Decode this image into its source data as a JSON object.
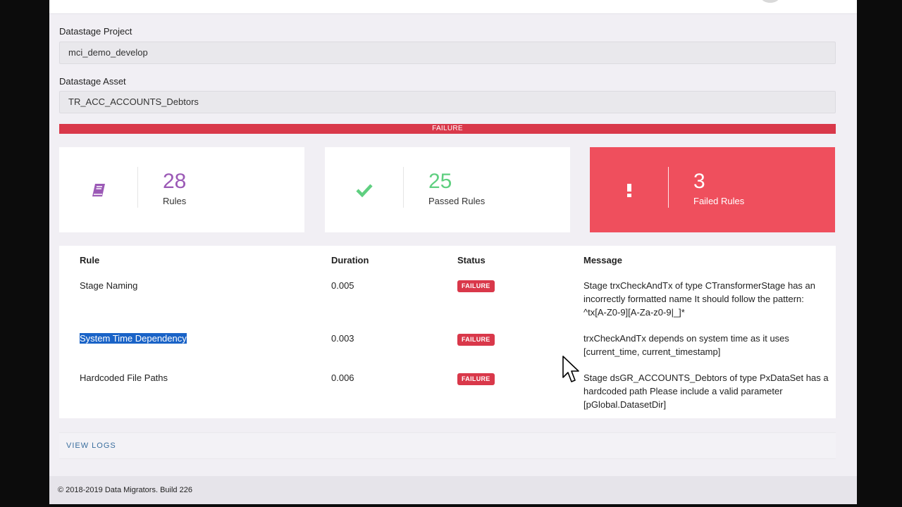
{
  "project": {
    "label": "Datastage Project",
    "value": "mci_demo_develop"
  },
  "asset": {
    "label": "Datastage Asset",
    "value": "TR_ACC_ACCOUNTS_Debtors"
  },
  "status_bar": {
    "text": "FAILURE",
    "color": "#d9384a"
  },
  "stats": [
    {
      "icon": "book-icon",
      "value": "28",
      "label": "Rules",
      "color": "#9b59b6"
    },
    {
      "icon": "check-icon",
      "value": "25",
      "label": "Passed Rules",
      "color": "#5fcf80"
    },
    {
      "icon": "exclamation-icon",
      "value": "3",
      "label": "Failed Rules",
      "color": "#ef4f5d"
    }
  ],
  "table": {
    "headers": {
      "rule": "Rule",
      "duration": "Duration",
      "status": "Status",
      "message": "Message"
    },
    "rows": [
      {
        "rule": "Stage Naming",
        "duration": "0.005",
        "status": "FAILURE",
        "message_lines": [
          "Stage trxCheckAndTx of type CTransformerStage has an",
          "incorrectly formatted name It should follow the pattern:",
          "^tx[A-Z0-9][A-Za-z0-9|_]*"
        ]
      },
      {
        "rule": "System Time Dependency",
        "duration": "0.003",
        "status": "FAILURE",
        "selected": true,
        "message_lines": [
          "trxCheckAndTx depends on system time as it uses",
          "[current_time, current_timestamp]"
        ]
      },
      {
        "rule": "Hardcoded File Paths",
        "duration": "0.006",
        "status": "FAILURE",
        "message_lines": [
          "Stage dsGR_ACCOUNTS_Debtors of type PxDataSet has a",
          "hardcoded path Please include a valid parameter",
          "[pGlobal.DatasetDir]"
        ]
      }
    ]
  },
  "view_logs": "VIEW LOGS",
  "footer": "© 2018-2019 Data Migrators. Build 226"
}
